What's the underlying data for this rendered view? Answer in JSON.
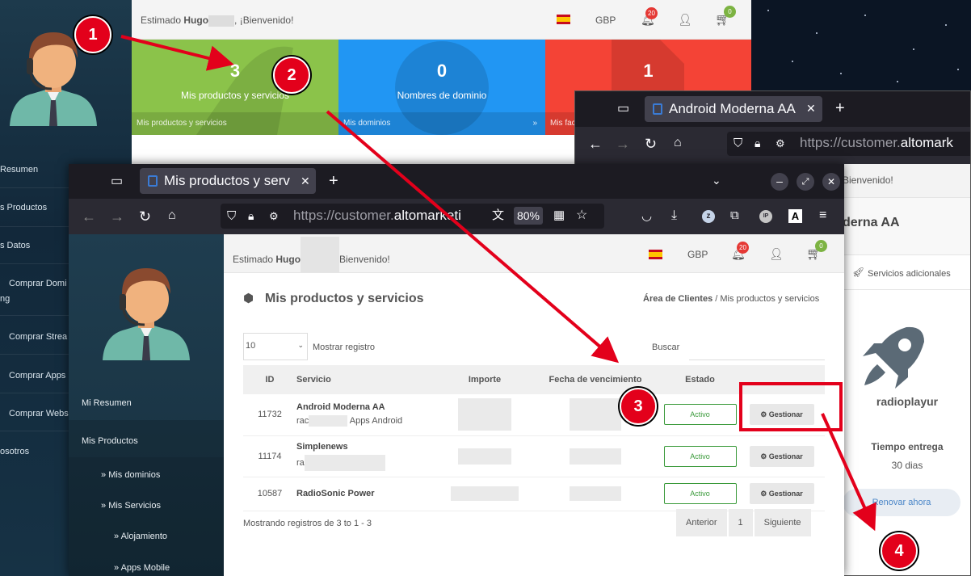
{
  "back_window": {
    "greeting_prefix": "Estimado",
    "user_name": "Hugo",
    "greeting_suffix": ", ¡Bienvenido!",
    "currency": "GBP",
    "notif_count": "20",
    "cart_count": "0",
    "sidebar": [
      "Resumen",
      "s Productos",
      "s Datos",
      "Comprar Domi",
      "ng",
      "Comprar Strea",
      "Comprar Apps",
      "Comprar Webs",
      "osotros"
    ],
    "cards": [
      {
        "num": "3",
        "label": "Mis productos y servicios",
        "foot": "Mis productos y servicios",
        "color": "#8bc34a"
      },
      {
        "num": "0",
        "label": "Nombres de dominio",
        "foot": "Mis dominios",
        "arrow": "»",
        "color": "#2196f3"
      },
      {
        "num": "1",
        "label": "",
        "foot": "Mis fac",
        "color": "#f44336"
      }
    ]
  },
  "right_window": {
    "tab_title": "Android Moderna AA",
    "url_prefix": "https://customer.",
    "url_domain": "altomark",
    "welcome": "Bienvenido!",
    "product_title": "derna AA",
    "extra_services": "Servicios adicionales",
    "app_name": "radioplayur",
    "delivery_label": "Tiempo entrega",
    "delivery_value": "30 dias",
    "renew_button": "Renovar ahora"
  },
  "front_window": {
    "tab_title": "Mis productos y serv",
    "url_prefix": "https://customer.",
    "url_domain": "altomarketi",
    "zoom": "80%",
    "greeting_prefix": "Estimado",
    "user_name": "Hugo",
    "greeting_suffix": "Bienvenido!",
    "currency": "GBP",
    "notif_count": "20",
    "cart_count": "0",
    "sidebar": {
      "resumen": "Mi Resumen",
      "productos": "Mis Productos",
      "dominios": "Mis dominios",
      "servicios": "Mis Servicios",
      "alojamiento": "Alojamiento",
      "apps": "Apps Mobile"
    },
    "page_title": "Mis productos y servicios",
    "breadcrumb_home": "Área de Clientes",
    "breadcrumb_current": "/ Mis productos y servicios",
    "per_page": "10",
    "show_records": "Mostrar registro",
    "search_label": "Buscar",
    "columns": [
      "ID",
      "Servicio",
      "Importe",
      "Fecha de vencimiento",
      "Estado"
    ],
    "rows": [
      {
        "id": "11732",
        "service": "Android Moderna AA",
        "sub_prefix": "rac",
        "sub_suffix": "Apps Android",
        "status": "Activo",
        "action": "Gestionar"
      },
      {
        "id": "11174",
        "service": "Simplenews",
        "sub_prefix": "ra",
        "sub_suffix": "",
        "status": "Activo",
        "action": "Gestionar"
      },
      {
        "id": "10587",
        "service": "RadioSonic Power",
        "sub_prefix": "",
        "sub_suffix": "",
        "status": "Activo",
        "action": "Gestionar"
      }
    ],
    "showing": "Mostrando registros de 3 to 1 - 3",
    "pagination": {
      "prev": "Anterior",
      "page": "1",
      "next": "Siguiente"
    }
  },
  "annotations": [
    "1",
    "2",
    "3",
    "4"
  ],
  "colors": {
    "annotation": "#e3001b",
    "active": "#3a9a3a",
    "sidebar": "#1f3d4f"
  }
}
